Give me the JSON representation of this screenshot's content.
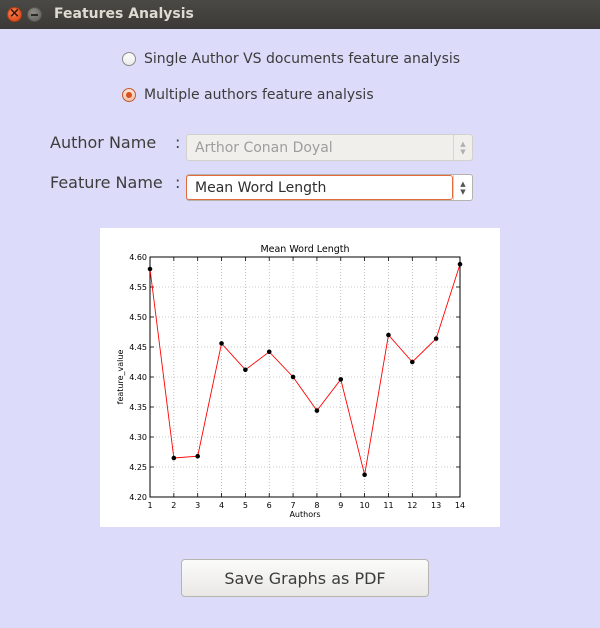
{
  "window": {
    "title": "Features Analysis"
  },
  "mode_options": [
    {
      "label": "Single Author VS documents feature analysis",
      "selected": false
    },
    {
      "label": "Multiple authors feature analysis",
      "selected": true
    }
  ],
  "form": {
    "author": {
      "label": "Author Name",
      "colon": ":",
      "value": "Arthor Conan Doyal",
      "enabled": false
    },
    "feature": {
      "label": "Feature Name",
      "colon": ":",
      "value": "Mean Word Length",
      "enabled": true
    }
  },
  "chart_data": {
    "type": "line",
    "title": "Mean Word Length",
    "xlabel": "Authors",
    "ylabel": "feature_value",
    "x": [
      1,
      2,
      3,
      4,
      5,
      6,
      7,
      8,
      9,
      10,
      11,
      12,
      13,
      14
    ],
    "series": [
      {
        "values": [
          4.58,
          4.265,
          4.268,
          4.456,
          4.412,
          4.442,
          4.4,
          4.344,
          4.396,
          4.237,
          4.47,
          4.425,
          4.464,
          4.588
        ],
        "color": "#ff0000",
        "marker": "dot"
      }
    ],
    "xlim": [
      1,
      14
    ],
    "ylim": [
      4.2,
      4.6
    ],
    "xticks": [
      "1",
      "2",
      "3",
      "4",
      "5",
      "6",
      "7",
      "8",
      "9",
      "10",
      "11",
      "12",
      "13",
      "14"
    ],
    "yticks": [
      "4.20",
      "4.25",
      "4.30",
      "4.35",
      "4.40",
      "4.45",
      "4.50",
      "4.55",
      "4.60"
    ],
    "grid": true
  },
  "actions": {
    "save_label": "Save Graphs as PDF"
  }
}
